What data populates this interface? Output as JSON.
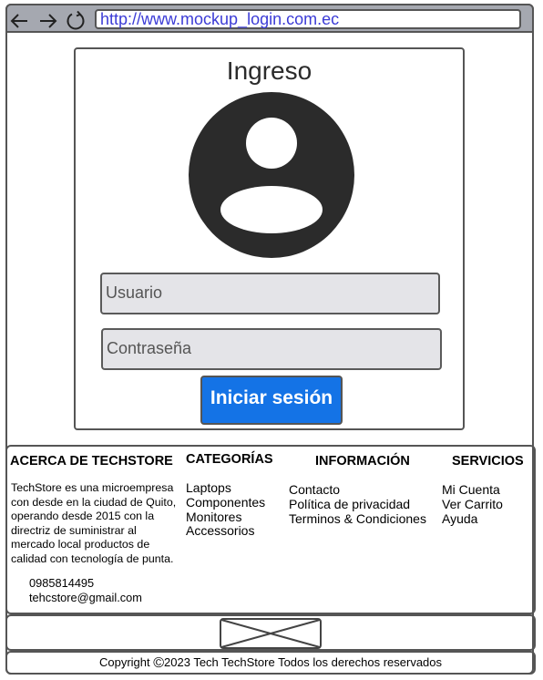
{
  "browser": {
    "url": "http://www.mockup_login.com.ec",
    "back_icon": "arrow-left-icon",
    "forward_icon": "arrow-right-icon",
    "reload_icon": "reload-icon"
  },
  "login": {
    "title": "Ingreso",
    "avatar_icon": "user-avatar-icon",
    "username_placeholder": "Usuario",
    "password_placeholder": "Contraseña",
    "submit_label": "Iniciar sesión",
    "submit_color": "#1473e6"
  },
  "footer": {
    "about": {
      "title": "ACERCA DE TECHSTORE",
      "lines": [
        "TechStore es una microempresa",
        "con desde en la ciudad de Quito,",
        "operando desde 2015 con la",
        "directriz de suministrar al",
        "mercado local productos de",
        "calidad con tecnología de punta."
      ],
      "phone": "0985814495",
      "email": "tehcstore@gmail.com"
    },
    "categories": {
      "title": "CATEGORÍAS",
      "items": [
        "Laptops",
        "Componentes",
        "Monitores",
        "Accessorios"
      ]
    },
    "info": {
      "title": "INFORMACIÓN",
      "items": [
        "Contacto",
        "Política de privacidad",
        "Terminos & Condiciones"
      ]
    },
    "services": {
      "title": "SERVICIOS",
      "items": [
        "Mi Cuenta",
        "Ver Carrito",
        "Ayuda"
      ]
    }
  },
  "image_placeholder_icon": "image-placeholder-icon",
  "copyright": {
    "prefix": "Copyright ",
    "symbol": "©",
    "text": "2023 Tech TechStore Todos los derechos reservados"
  }
}
